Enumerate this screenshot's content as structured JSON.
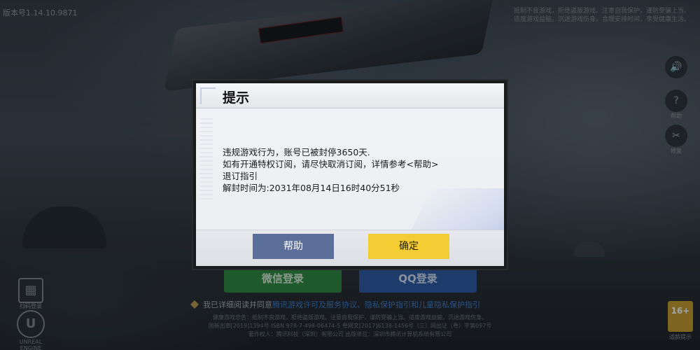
{
  "background": {
    "version_text": "版本号1.14.10.9871",
    "top_notice_lines": [
      "抵制不良游戏，拒绝盗版游戏。注意自我保护，谨防受骗上当。",
      "适度游戏益脑，沉迷游戏伤身。合理安排时间，享受健康生活。"
    ],
    "side_buttons": [
      {
        "icon": "🔊",
        "label": ""
      },
      {
        "icon": "?",
        "label": "帮助"
      },
      {
        "icon": "✂",
        "label": "修复"
      }
    ],
    "login_wechat_label": "微信登录",
    "login_qq_label": "QQ登录",
    "agree_prefix": "我已详细阅读并同意",
    "agree_links": "腾讯游戏许可及服务协议、隐私保护指引和儿童隐私保护指引",
    "footer_lines": [
      "健康游戏忠告：抵制不良游戏，拒绝盗版游戏。注意自我保护，谨防受骗上当。适度游戏益脑，沉迷游戏伤身。",
      "国新出审[2019]1394号  ISBN 978-7-498-06474-5  粤网文[2017]6138-1456号（三）网出证（粤）字第097号",
      "著作权人：腾讯科技（深圳）有限公司  出版单位：深圳市腾讯计算机系统有限公司"
    ],
    "qr_label": "扫码登录",
    "unreal_label": "UNREAL ENGINE",
    "age_badge": "16+",
    "age_label": "适龄提示"
  },
  "modal": {
    "title": "提示",
    "body_lines": [
      "违规游戏行为，账号已被封停3650天.",
      "如有开通特权订阅，请尽快取消订阅，详情参考<帮助>",
      "退订指引",
      "解封时间为:2031年08月14日16时40分51秒"
    ],
    "help_label": "帮助",
    "confirm_label": "确定"
  }
}
